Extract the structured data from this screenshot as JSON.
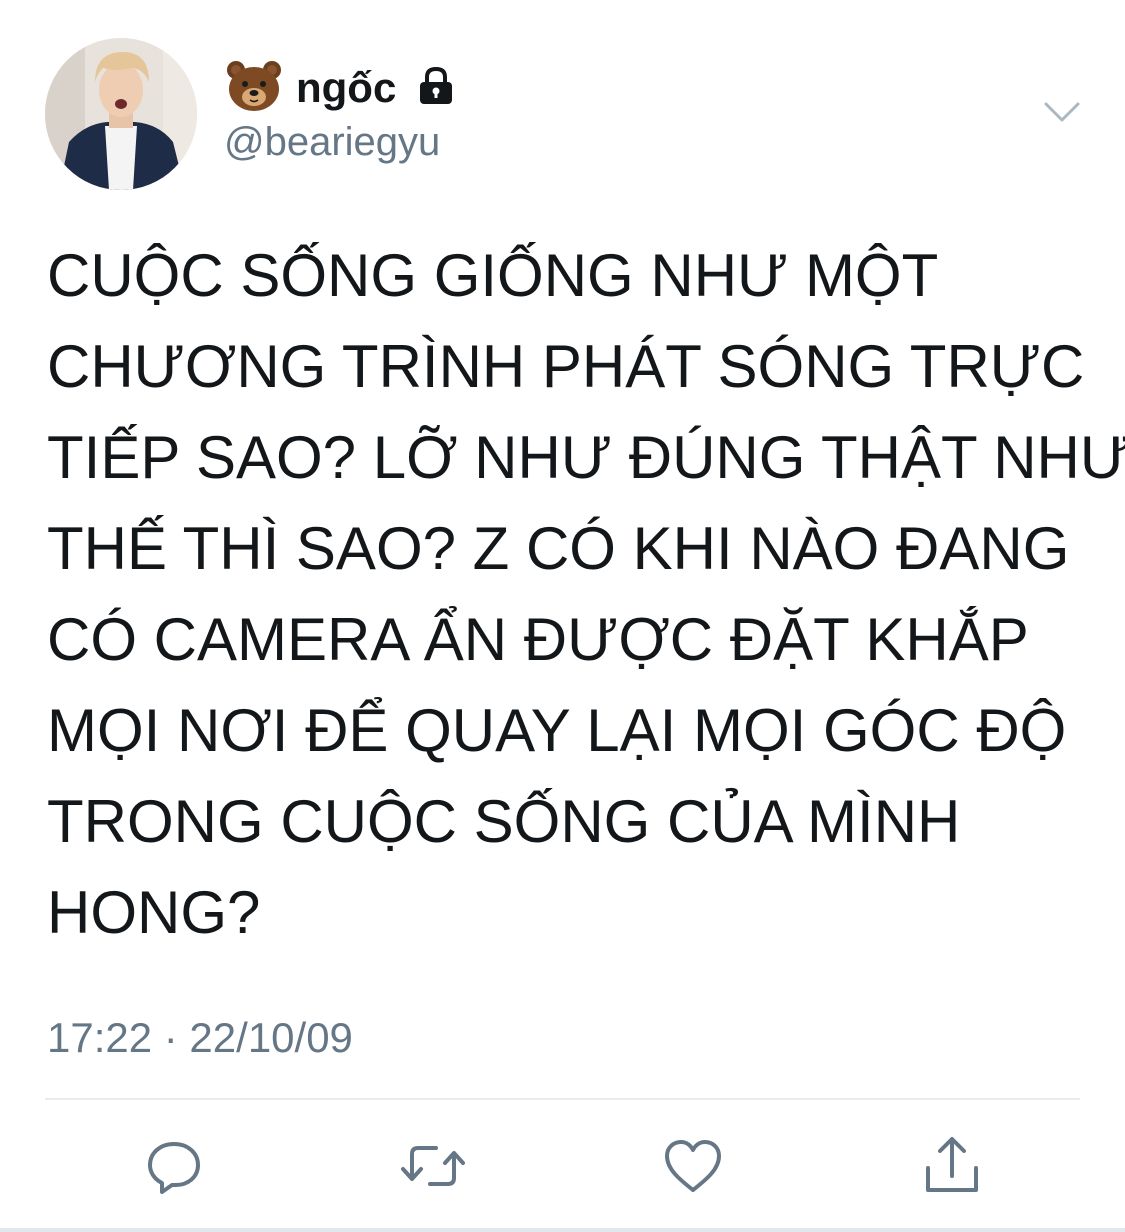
{
  "author": {
    "emoji": "🐻",
    "display_name": "ngốc",
    "handle": "@beariegyu",
    "locked": true
  },
  "tweet": {
    "lines": [
      "CUỘC SỐNG GIỐNG NHƯ MỘT",
      "CHƯƠNG TRÌNH PHÁT SÓNG TRỰC",
      "TIẾP SAO? LỠ NHƯ ĐÚNG THẬT NHƯ",
      "THẾ THÌ SAO? Z CÓ KHI NÀO ĐANG",
      "CÓ CAMERA ẨN ĐƯỢC ĐẶT KHẮP",
      "MỌI NƠI ĐỂ QUAY LẠI MỌI GÓC ĐỘ",
      "TRONG CUỘC SỐNG CỦA MÌNH",
      "HONG?"
    ],
    "timestamp": "17:22 · 22/10/09"
  },
  "icons": {
    "caret": "chevron-down-icon",
    "reply": "reply-icon",
    "retweet": "retweet-icon",
    "like": "heart-icon",
    "share": "share-icon",
    "lock": "lock-icon"
  },
  "colors": {
    "text": "#14171a",
    "secondary": "#657786",
    "divider": "#e6ecf0",
    "icon": "#657786"
  }
}
